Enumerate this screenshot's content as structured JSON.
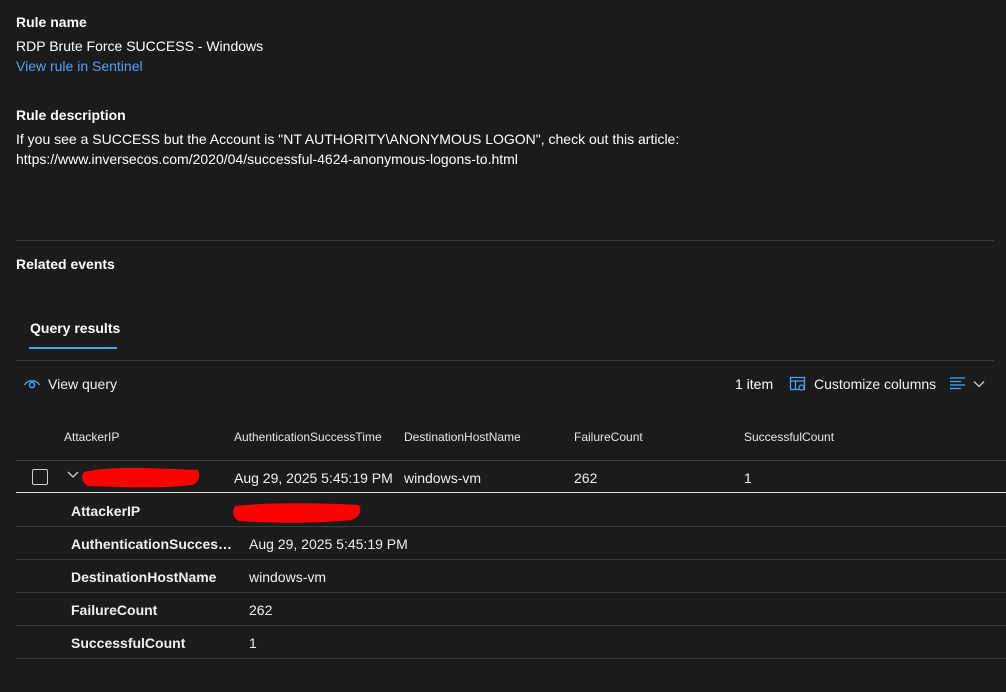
{
  "rule": {
    "name_label": "Rule name",
    "name_value": "RDP Brute Force SUCCESS - Windows",
    "view_link": "View rule in Sentinel",
    "description_label": "Rule description",
    "description_value": "If you see a SUCCESS but the Account is \"NT AUTHORITY\\ANONYMOUS LOGON\", check out this article: https://www.inversecos.com/2020/04/successful-4624-anonymous-logons-to.html"
  },
  "related_events_label": "Related events",
  "tabs": [
    {
      "label": "Query results",
      "active": true
    }
  ],
  "toolbar": {
    "view_query": "View query",
    "item_count": "1 item",
    "customize_columns": "Customize columns"
  },
  "table": {
    "columns": [
      "AttackerIP",
      "AuthenticationSuccessTime",
      "DestinationHostName",
      "FailureCount",
      "SuccessfulCount"
    ],
    "rows": [
      {
        "AttackerIP": "",
        "AuthenticationSuccessTime": "Aug 29, 2025 5:45:19 PM",
        "DestinationHostName": "windows-vm",
        "FailureCount": "262",
        "SuccessfulCount": "1"
      }
    ],
    "expanded_details": [
      {
        "label": "AttackerIP",
        "value": ""
      },
      {
        "label": "AuthenticationSuccessTi...",
        "value": "Aug 29, 2025 5:45:19 PM"
      },
      {
        "label": "DestinationHostName",
        "value": "windows-vm"
      },
      {
        "label": "FailureCount",
        "value": "262"
      },
      {
        "label": "SuccessfulCount",
        "value": "1"
      }
    ]
  },
  "colors": {
    "accent": "#4aa3f0",
    "background": "#1b1b1b",
    "redaction": "#ff0000"
  },
  "icons": [
    "eye-icon",
    "customize-columns-icon",
    "density-icon",
    "chevron-down-icon",
    "expand-chevron-icon",
    "checkbox-icon"
  ]
}
